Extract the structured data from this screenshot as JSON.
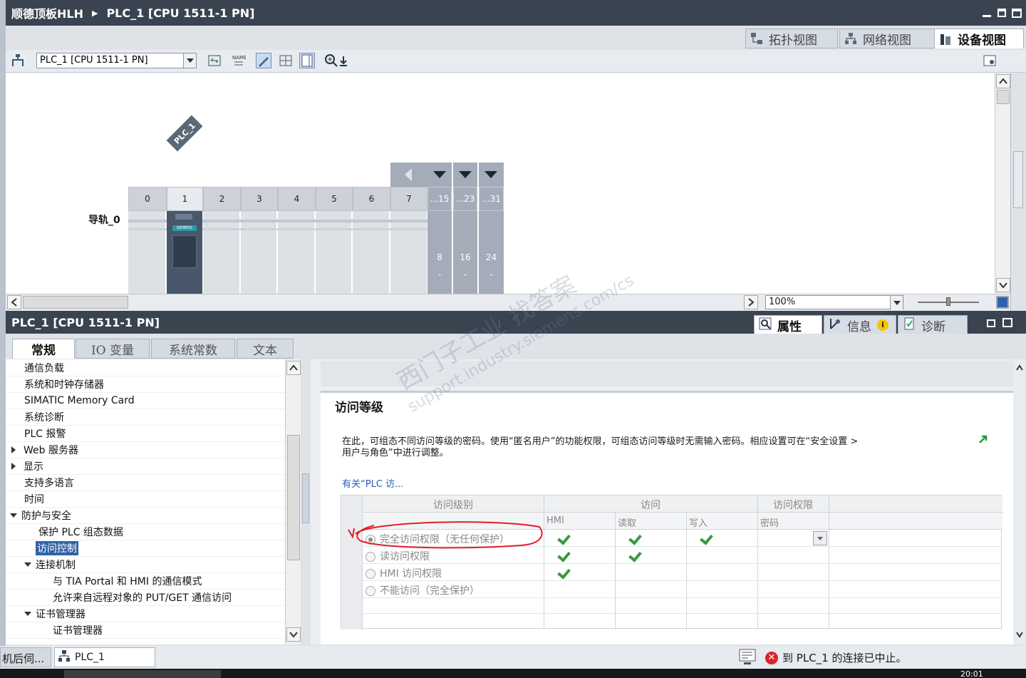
{
  "titlebar": {
    "project": "顺德顶板HLH",
    "device": "PLC_1 [CPU 1511-1 PN]"
  },
  "view_tabs": [
    "拓扑视图",
    "网络视图",
    "设备视图"
  ],
  "toolbar": {
    "device_select": "PLC_1 [CPU 1511-1 PN]",
    "zoom": "100%"
  },
  "canvas": {
    "plc_tag": "PLC_1",
    "rail_label": "导轨_0",
    "slots": [
      "0",
      "1",
      "2",
      "3",
      "4",
      "5",
      "6",
      "7"
    ],
    "ext_headers": [
      "...15",
      "...23",
      "...31"
    ],
    "ext_numbers": [
      "8",
      "16",
      "24"
    ],
    "ext_dash": "-",
    "module_brand": "SIEMENS"
  },
  "properties": {
    "title": "PLC_1 [CPU 1511-1 PN]",
    "panel_tabs": [
      "属性",
      "信息",
      "诊断"
    ],
    "sub_tabs": [
      "常规",
      "IO 变量",
      "系统常数",
      "文本"
    ]
  },
  "tree": {
    "items": [
      {
        "label": "通信负载",
        "level": 1
      },
      {
        "label": "系统和时钟存储器",
        "level": 1
      },
      {
        "label": "SIMATIC Memory Card",
        "level": 1
      },
      {
        "label": "系统诊断",
        "level": 1
      },
      {
        "label": "PLC 报警",
        "level": 1
      },
      {
        "label": "Web 服务器",
        "level": 1
      },
      {
        "label": "显示",
        "level": 1
      },
      {
        "label": "支持多语言",
        "level": 1
      },
      {
        "label": "时间",
        "level": 1
      },
      {
        "label": "防护与安全",
        "level": 1
      },
      {
        "label": "保护 PLC 组态数据",
        "level": 2
      },
      {
        "label": "访问控制",
        "level": 2
      },
      {
        "label": "连接机制",
        "level": 2
      },
      {
        "label": "与 TIA Portal 和 HMI 的通信模式",
        "level": 3
      },
      {
        "label": "允许来自远程对象的 PUT/GET 通信访问",
        "level": 3
      },
      {
        "label": "证书管理器",
        "level": 2
      },
      {
        "label": "证书管理器",
        "level": 3
      }
    ]
  },
  "access": {
    "section_title": "访问等级",
    "description_line1": "在此，可组态不同访问等级的密码。使用“匿名用户”的功能权限，可组态访问等级时无需输入密码。相应设置可在“安全设置 >",
    "description_line2": "用户与角色”中进行调整。",
    "link": "有关“PLC 访...",
    "header_level": "访问级别",
    "header_access": "访问",
    "header_rights": "访问权限",
    "sub_hmi": "HMI",
    "sub_read": "读取",
    "sub_write": "写入",
    "sub_password": "密码",
    "rows": [
      {
        "label": "完全访问权限（无任何保护）",
        "hmi": true,
        "read": true,
        "write": true,
        "selected": true
      },
      {
        "label": "读访问权限",
        "hmi": true,
        "read": true,
        "write": false,
        "selected": false
      },
      {
        "label": "HMI 访问权限",
        "hmi": true,
        "read": false,
        "write": false,
        "selected": false
      },
      {
        "label": "不能访问（完全保护）",
        "hmi": false,
        "read": false,
        "write": false,
        "selected": false
      }
    ],
    "next_section_partial": "完全访问权限（无任何保护）"
  },
  "statusbar": {
    "message": "到 PLC_1 的连接已中止。"
  },
  "taskbar": {
    "item1": "机后伺...",
    "item2": "PLC_1",
    "clock": "20:01"
  },
  "watermark": {
    "line1": "西门子工业 找答案",
    "line2": "support.industry.siemens.com/cs"
  },
  "colors": {
    "titlebar": "#3a4451",
    "selection": "#2f63a8",
    "check": "#3a9a3a",
    "annotation": "#e0202a",
    "link": "#2a5db0"
  }
}
